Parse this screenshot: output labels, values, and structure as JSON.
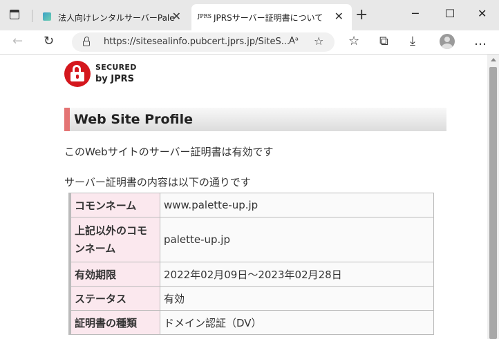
{
  "browser": {
    "tabs": [
      {
        "title": "法人向けレンタルサーバーPalette U",
        "favicon": "palette-favicon"
      },
      {
        "title": "JPRSサーバー証明書について",
        "favicon_text": "JPRS"
      }
    ],
    "address": {
      "url": "https://sitesealinfo.pubcert.jprs.jp/SiteS..."
    },
    "window_controls": {
      "minimize": "─",
      "maximize": "☐",
      "close": "✕"
    },
    "icons": {
      "back": "←",
      "refresh": "↻",
      "read_aloud": "Aᵃ",
      "favorite": "☆",
      "favorites_menu": "☆",
      "collections": "⧉",
      "downloads": "⤓",
      "menu": "…",
      "new_tab": "+",
      "tab_close": "✕"
    }
  },
  "seal": {
    "line1": "SECURED",
    "line2": "by JPRS",
    "color": "#d4171d"
  },
  "page": {
    "heading": "Web Site Profile",
    "valid_text": "このWebサイトのサーバー証明書は有効です",
    "intro_text": "サーバー証明書の内容は以下の通りです",
    "rows": [
      {
        "key": "コモンネーム",
        "value": "www.palette-up.jp"
      },
      {
        "key": "上記以外のコモンネーム",
        "value": "palette-up.jp"
      },
      {
        "key": "有効期限",
        "value": "2022年02月09日～2023年02月28日"
      },
      {
        "key": "ステータス",
        "value": "有効"
      },
      {
        "key": "証明書の種類",
        "value": "ドメイン認証（DV）"
      }
    ]
  }
}
